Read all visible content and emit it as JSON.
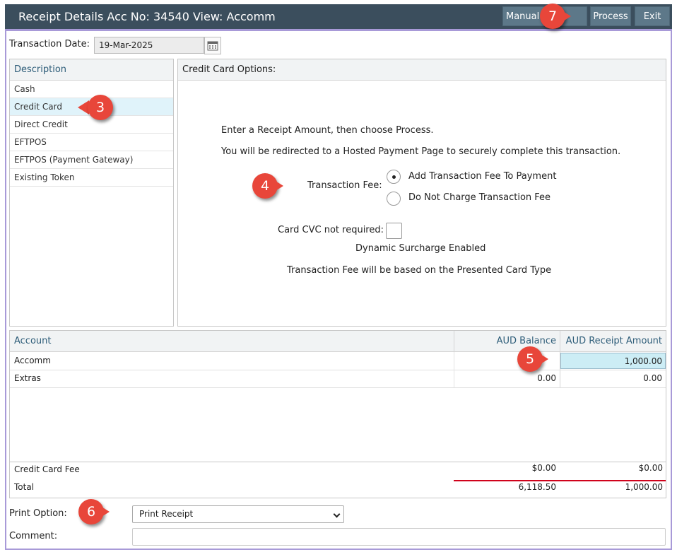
{
  "titlebar": {
    "title": "Receipt Details Acc No: 34540 View: Accomm",
    "buttons": {
      "manual": "Manual",
      "process": "Process",
      "exit": "Exit"
    },
    "bg_color": "#3b4e5d",
    "button_color": "#5d7889"
  },
  "transaction_date": {
    "label": "Transaction Date:",
    "value": "19-Mar-2025"
  },
  "description_panel": {
    "header": "Description",
    "items": [
      "Cash",
      "Credit Card",
      "Direct Credit",
      "EFTPOS",
      "EFTPOS (Payment Gateway)",
      "Existing Token"
    ],
    "selected": "Credit Card"
  },
  "credit_card_options": {
    "header": "Credit Card Options:",
    "line1": "Enter a Receipt Amount, then choose Process.",
    "line2": "You will be redirected to a Hosted Payment Page to securely complete this transaction.",
    "fee_label": "Transaction Fee:",
    "fee_options": [
      {
        "label": "Add Transaction Fee To Payment",
        "checked": true
      },
      {
        "label": "Do Not Charge Transaction Fee",
        "checked": false
      }
    ],
    "cvc_label": "Card CVC not required:",
    "cvc_checked": false,
    "surcharge_text": "Dynamic Surcharge Enabled",
    "fee_note": "Transaction Fee will be based on the Presented Card Type"
  },
  "accounts_grid": {
    "headers": {
      "account": "Account",
      "balance": "AUD Balance",
      "receipt": "AUD Receipt Amount"
    },
    "rows": [
      {
        "account": "Accomm",
        "balance": "",
        "receipt": "1,000.00"
      },
      {
        "account": "Extras",
        "balance": "0.00",
        "receipt": "0.00"
      }
    ],
    "fee_row": {
      "label": "Credit Card Fee",
      "balance": "$0.00",
      "receipt": "$0.00"
    },
    "total_row": {
      "label": "Total",
      "balance": "6,118.50",
      "receipt": "1,000.00"
    }
  },
  "print_option": {
    "label": "Print Option:",
    "value": "Print Receipt"
  },
  "comment": {
    "label": "Comment:",
    "value": ""
  },
  "callouts": [
    "3",
    "4",
    "5",
    "6",
    "7"
  ],
  "colors": {
    "accent_border": "#a89ad8",
    "callout": "#e8463a",
    "selected_row": "#e0f3fa",
    "total_rule": "#d0021b"
  }
}
